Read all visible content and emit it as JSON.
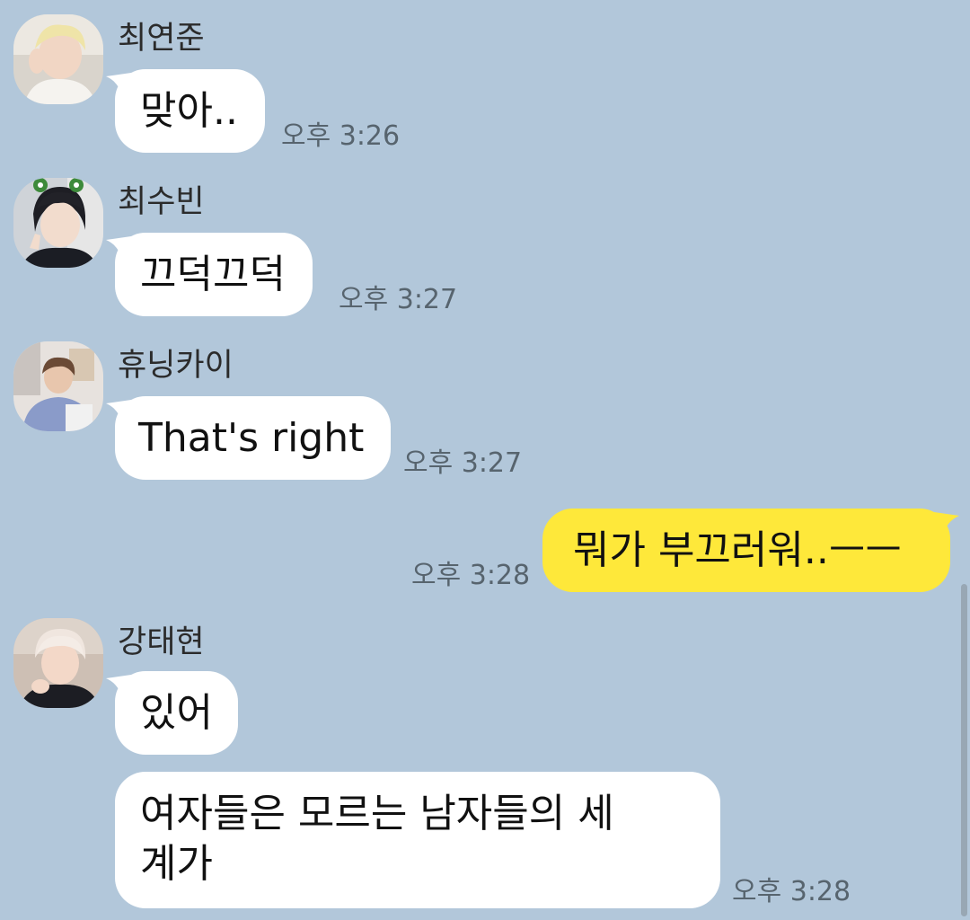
{
  "messages": [
    {
      "sender": "최연준",
      "text": "맞아..",
      "time": "오후 3:26"
    },
    {
      "sender": "최수빈",
      "text": "끄덕끄덕",
      "time": "오후 3:27"
    },
    {
      "sender": "휴닝카이",
      "text": "That's right",
      "time": "오후 3:27"
    },
    {
      "sender": "",
      "text": "뭐가 부끄러워..ㅡㅡ",
      "time": "오후 3:28",
      "mine": true
    },
    {
      "sender": "강태현",
      "text": "있어",
      "time": ""
    },
    {
      "sender": "",
      "text": "여자들은 모르는 남자들의 세계가",
      "time": "오후 3:28"
    }
  ],
  "colors": {
    "background": "#b2c7da",
    "incoming_bubble": "#ffffff",
    "outgoing_bubble": "#fee83a"
  }
}
